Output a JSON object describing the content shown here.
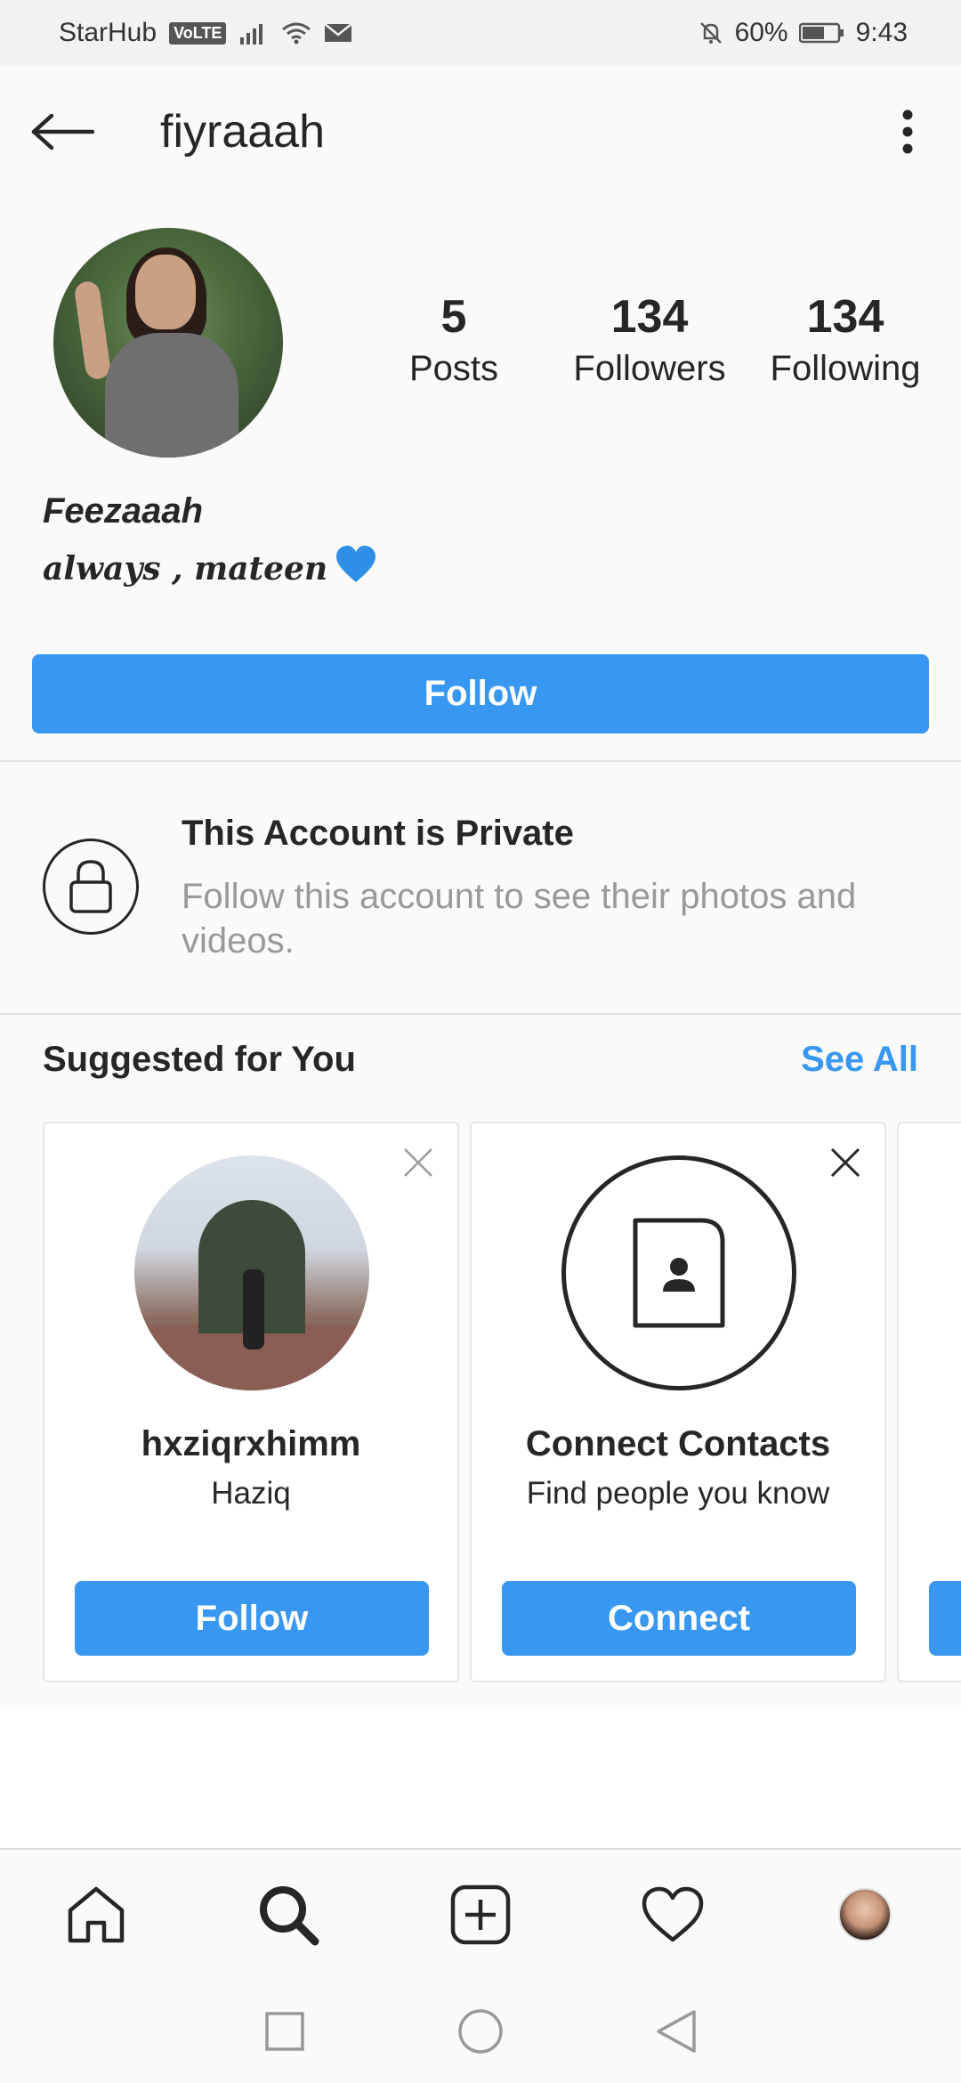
{
  "status_bar": {
    "carrier": "StarHub",
    "volte": "VoLTE",
    "battery": "60%",
    "time": "9:43"
  },
  "header": {
    "username": "fiyraaah"
  },
  "profile": {
    "stats": [
      {
        "value": "5",
        "label": "Posts"
      },
      {
        "value": "134",
        "label": "Followers"
      },
      {
        "value": "134",
        "label": "Following"
      }
    ],
    "full_name": "Feezaaah",
    "bio": "always , mateen",
    "follow_label": "Follow"
  },
  "private_notice": {
    "title": "This Account is Private",
    "description": "Follow this account to see their photos and videos."
  },
  "suggested": {
    "title": "Suggested for You",
    "see_all": "See All",
    "cards": [
      {
        "name": "hxziqrxhimm",
        "subtitle": "Haziq",
        "button": "Follow"
      },
      {
        "name": "Connect Contacts",
        "subtitle": "Find people you know",
        "button": "Connect"
      }
    ]
  },
  "colors": {
    "accent": "#3897f0",
    "text": "#262626",
    "muted": "#999999"
  },
  "icons": {
    "back": "arrow-left-icon",
    "more": "vertical-dots-icon",
    "lock": "lock-icon",
    "close": "close-icon",
    "contacts": "contact-book-icon",
    "nav": [
      "home-icon",
      "search-icon",
      "add-post-icon",
      "heart-icon",
      "profile-avatar"
    ],
    "system": [
      "square-recent-icon",
      "circle-home-icon",
      "triangle-back-icon"
    ]
  }
}
